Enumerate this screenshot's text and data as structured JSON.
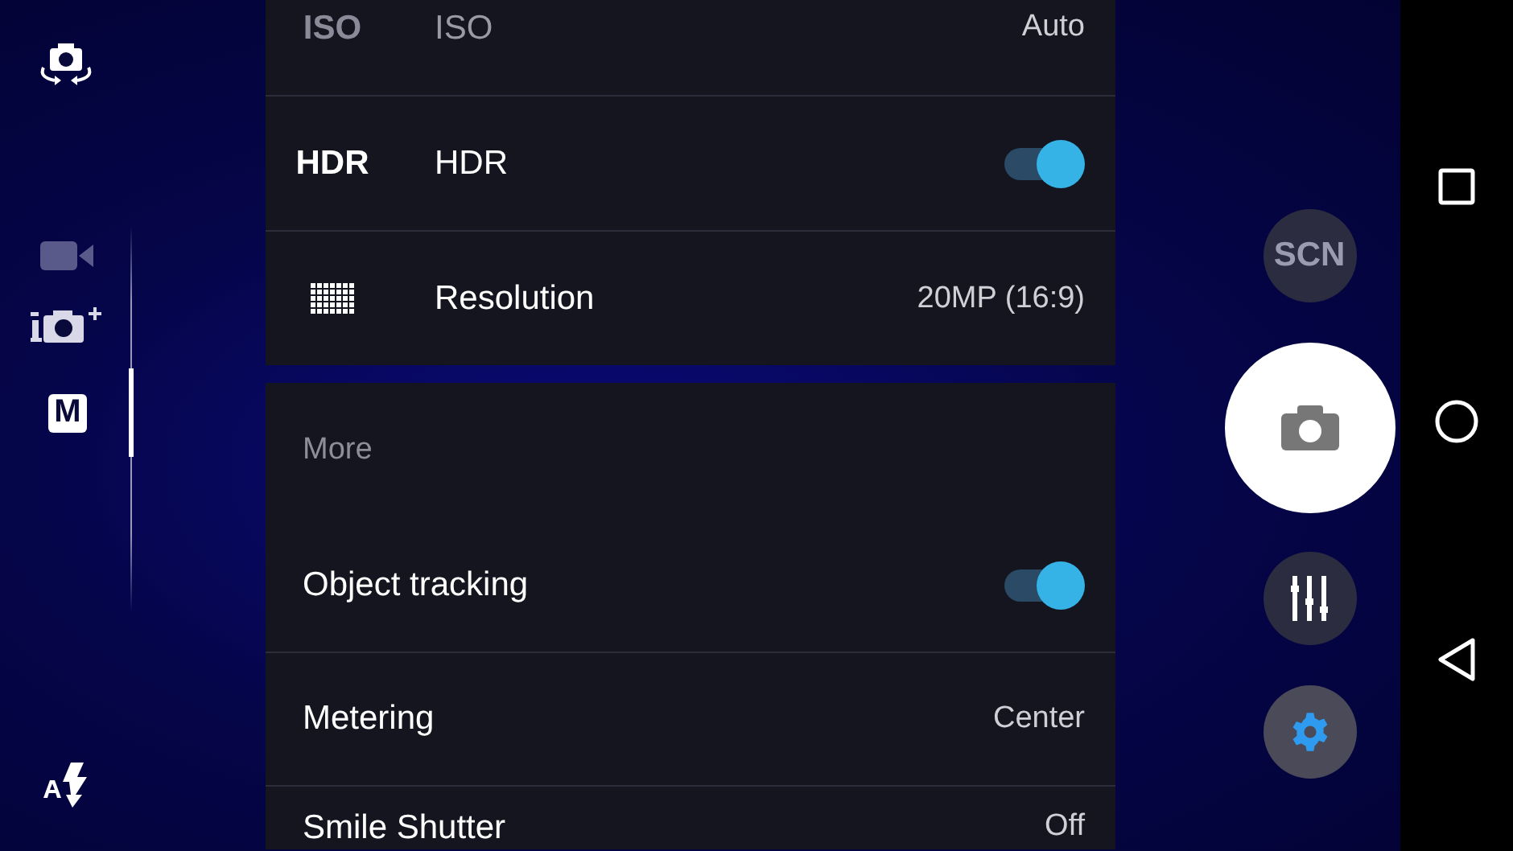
{
  "modes": [
    {
      "kind": "video",
      "selected": false,
      "disabled": true
    },
    {
      "kind": "superior-auto",
      "selected": false,
      "disabled": false
    },
    {
      "kind": "manual",
      "label": "M",
      "selected": true,
      "disabled": false
    }
  ],
  "settings_sections": [
    {
      "items": [
        {
          "kind": "value",
          "icon_label": "ISO",
          "label": "ISO",
          "value": "Auto",
          "disabled": true
        },
        {
          "kind": "toggle",
          "icon_label": "HDR",
          "label": "HDR",
          "on": true,
          "disabled": false
        },
        {
          "kind": "value",
          "label": "Resolution",
          "value": "20MP (16:9)",
          "disabled": false
        }
      ]
    },
    {
      "header": "More",
      "items": [
        {
          "kind": "toggle",
          "label": "Object tracking",
          "on": true,
          "disabled": false
        },
        {
          "kind": "value",
          "label": "Metering",
          "value": "Center",
          "disabled": false
        },
        {
          "kind": "value",
          "label": "Smile Shutter",
          "value": "Off",
          "disabled": false
        }
      ]
    }
  ],
  "controls": {
    "scene_label": "SCN",
    "settings_selected": true
  }
}
